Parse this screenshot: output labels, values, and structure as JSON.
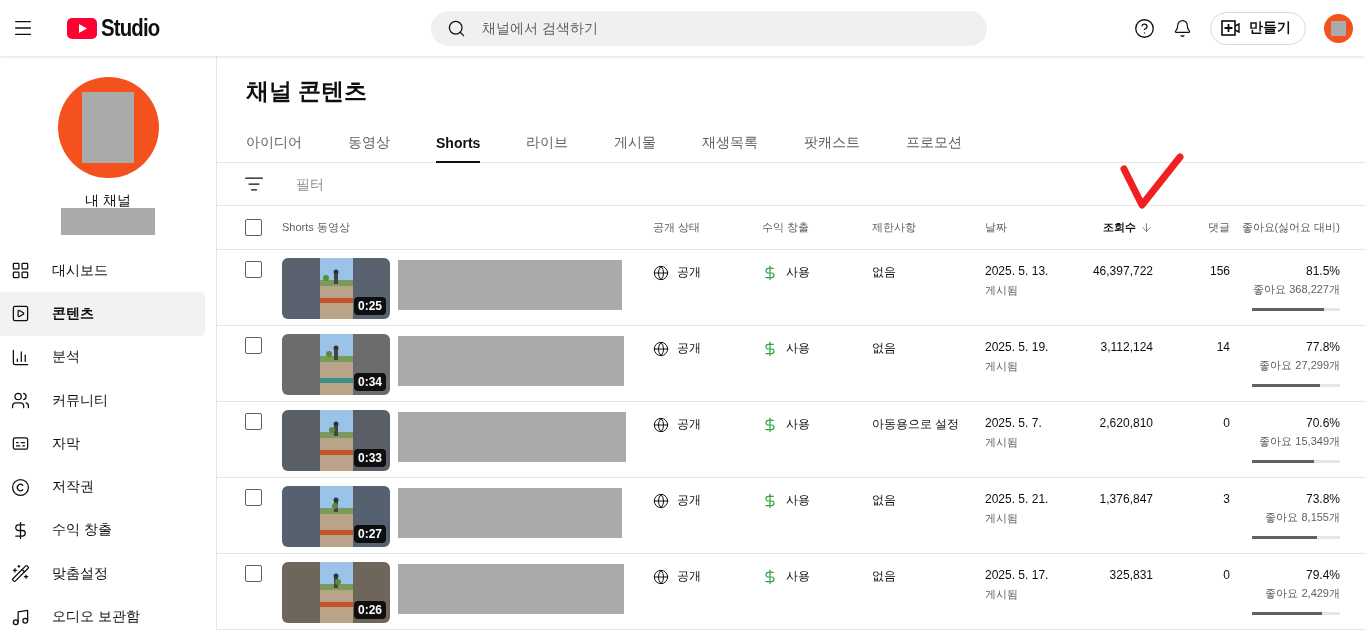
{
  "header": {
    "logo_text": "Studio",
    "search": {
      "placeholder": "채널에서 검색하기"
    },
    "create_label": "만들기"
  },
  "sidebar": {
    "channel_label": "내 채널",
    "items": [
      {
        "kind": "dashboard",
        "label": "대시보드",
        "selected": false
      },
      {
        "kind": "content",
        "label": "콘텐츠",
        "selected": true
      },
      {
        "kind": "analytics",
        "label": "분석",
        "selected": false
      },
      {
        "kind": "community",
        "label": "커뮤니티",
        "selected": false
      },
      {
        "kind": "subtitles",
        "label": "자막",
        "selected": false
      },
      {
        "kind": "copyright",
        "label": "저작권",
        "selected": false
      },
      {
        "kind": "monetization",
        "label": "수익 창출",
        "selected": false
      },
      {
        "kind": "customization",
        "label": "맞춤설정",
        "selected": false
      },
      {
        "kind": "audio",
        "label": "오디오 보관함",
        "selected": false
      }
    ]
  },
  "page_title": "채널 콘텐츠",
  "tabs": [
    {
      "label": "아이디어",
      "selected": false
    },
    {
      "label": "동영상",
      "selected": false
    },
    {
      "label": "Shorts",
      "selected": true
    },
    {
      "label": "라이브",
      "selected": false
    },
    {
      "label": "게시물",
      "selected": false
    },
    {
      "label": "재생목록",
      "selected": false
    },
    {
      "label": "팟캐스트",
      "selected": false
    },
    {
      "label": "프로모션",
      "selected": false
    }
  ],
  "filter": {
    "placeholder": "필터"
  },
  "table": {
    "all_checked": false,
    "columns": [
      {
        "label": "Shorts 동영상",
        "sorted": false
      },
      {
        "label": "공개 상태",
        "sorted": false
      },
      {
        "label": "수익 창출",
        "sorted": false
      },
      {
        "label": "제한사항",
        "sorted": false
      },
      {
        "label": "날짜",
        "sorted": false
      },
      {
        "label": "조회수",
        "sorted": true
      },
      {
        "label": "댓글",
        "sorted": false
      },
      {
        "label": "좋아요(싫어요 대비)",
        "sorted": false
      }
    ],
    "rows": [
      {
        "checked": false,
        "duration": "0:25",
        "visibility": "공개",
        "monetization": "사용",
        "restrictions": "없음",
        "date": "2025. 5. 13.",
        "date_status": "게시됨",
        "views": "46,397,722",
        "comments": "156",
        "like_ratio": "81.5%",
        "likes": "좋아요 368,227개",
        "level": 0.815
      },
      {
        "checked": false,
        "duration": "0:34",
        "visibility": "공개",
        "monetization": "사용",
        "restrictions": "없음",
        "date": "2025. 5. 19.",
        "date_status": "게시됨",
        "views": "3,112,124",
        "comments": "14",
        "like_ratio": "77.8%",
        "likes": "좋아요 27,299개",
        "level": 0.778
      },
      {
        "checked": false,
        "duration": "0:33",
        "visibility": "공개",
        "monetization": "사용",
        "restrictions": "아동용으로 설정",
        "date": "2025. 5. 7.",
        "date_status": "게시됨",
        "views": "2,620,810",
        "comments": "0",
        "like_ratio": "70.6%",
        "likes": "좋아요 15,349개",
        "level": 0.706
      },
      {
        "checked": false,
        "duration": "0:27",
        "visibility": "공개",
        "monetization": "사용",
        "restrictions": "없음",
        "date": "2025. 5. 21.",
        "date_status": "게시됨",
        "views": "1,376,847",
        "comments": "3",
        "like_ratio": "73.8%",
        "likes": "좋아요 8,155개",
        "level": 0.738
      },
      {
        "checked": false,
        "duration": "0:26",
        "visibility": "공개",
        "monetization": "사용",
        "restrictions": "없음",
        "date": "2025. 5. 17.",
        "date_status": "게시됨",
        "views": "325,831",
        "comments": "0",
        "like_ratio": "79.4%",
        "likes": "좋아요 2,429개",
        "level": 0.794
      }
    ]
  }
}
